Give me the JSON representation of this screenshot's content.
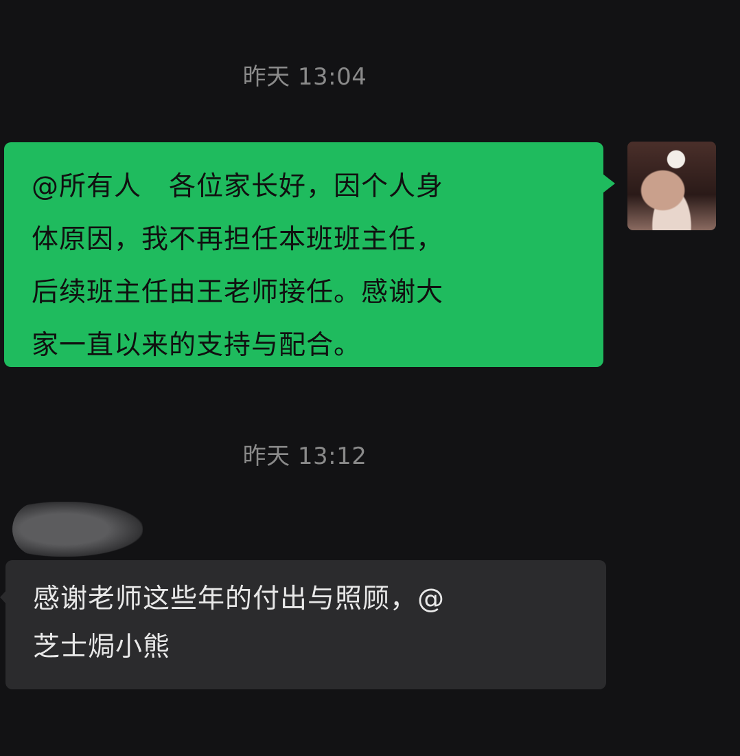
{
  "messages": [
    {
      "timestamp": "昨天 13:04",
      "direction": "outgoing",
      "lines": [
        "@所有人　各位家长好，因个人身",
        "体原因，我不再担任本班班主任，",
        "后续班主任由王老师接任。感谢大",
        "家一直以来的支持与配合。"
      ],
      "avatar_icon": "user-avatar"
    },
    {
      "timestamp": "昨天 13:12",
      "direction": "incoming",
      "lines": [
        "感谢老师这些年的付出与照顾，@",
        "芝士焗小熊"
      ]
    }
  ],
  "colors": {
    "background": "#121214",
    "outgoing_bubble": "#1fbb5e",
    "incoming_bubble": "#2b2b2d",
    "timestamp": "#8a8a8a"
  }
}
